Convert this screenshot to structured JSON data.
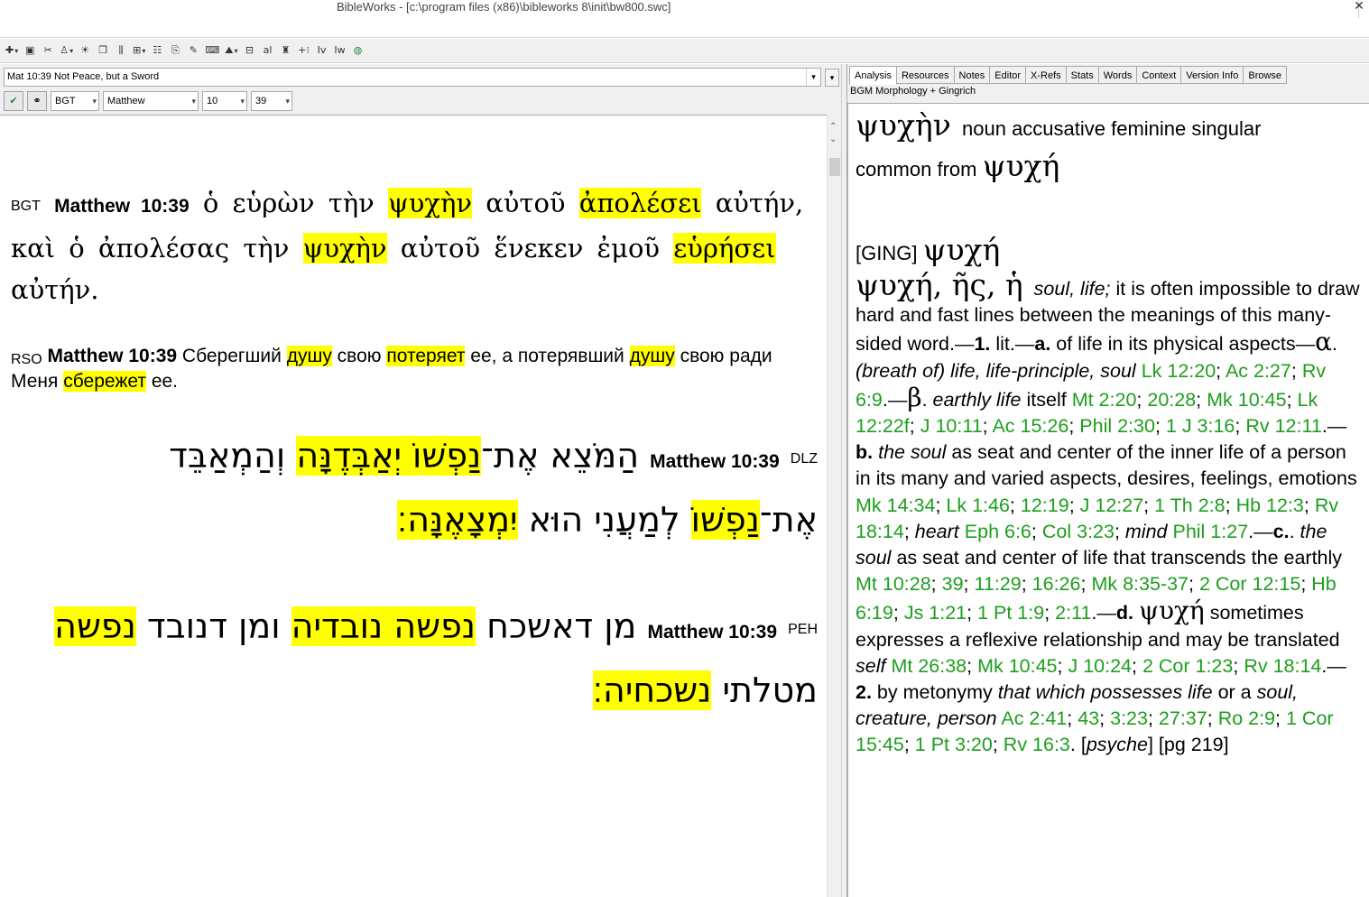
{
  "window": {
    "title": "BibleWorks - [c:\\program files (x86)\\bibleworks 8\\init\\bw800.swc]",
    "close_glyph": "✕"
  },
  "toolbar": {
    "buttons": [
      {
        "name": "toolbar-1-icon",
        "glyph": "✚",
        "dropdown": true
      },
      {
        "name": "toolbar-2-icon",
        "glyph": "▣",
        "dropdown": false
      },
      {
        "name": "toolbar-3-icon",
        "glyph": "✂",
        "dropdown": false
      },
      {
        "name": "toolbar-4-icon",
        "glyph": "♙",
        "dropdown": true
      },
      {
        "name": "toolbar-5-icon",
        "glyph": "☀",
        "dropdown": false
      },
      {
        "name": "toolbar-6-icon",
        "glyph": "❐",
        "dropdown": false
      },
      {
        "name": "toolbar-7-icon",
        "glyph": "⫼",
        "dropdown": false
      },
      {
        "name": "toolbar-8-icon",
        "glyph": "⊞",
        "dropdown": true
      },
      {
        "name": "toolbar-9-icon",
        "glyph": "☷",
        "dropdown": false
      },
      {
        "name": "toolbar-10-icon",
        "glyph": "⎘",
        "dropdown": false
      },
      {
        "name": "toolbar-11-icon",
        "glyph": "✎",
        "dropdown": false
      },
      {
        "name": "toolbar-12-icon",
        "glyph": "⌨",
        "dropdown": false
      },
      {
        "name": "toolbar-13-icon",
        "glyph": "⛰",
        "dropdown": true
      },
      {
        "name": "toolbar-14-icon",
        "glyph": "⊟",
        "dropdown": false
      },
      {
        "name": "toolbar-15-icon",
        "glyph": "al",
        "dropdown": false
      },
      {
        "name": "toolbar-16-icon",
        "glyph": "♜",
        "dropdown": false
      },
      {
        "name": "toolbar-17-icon",
        "glyph": "+⁝",
        "dropdown": false
      },
      {
        "name": "toolbar-18-icon",
        "glyph": "Iv",
        "dropdown": false
      },
      {
        "name": "toolbar-19-icon",
        "glyph": "Iw",
        "dropdown": false
      },
      {
        "name": "globe-icon",
        "glyph": "◍",
        "dropdown": false
      }
    ]
  },
  "left": {
    "reference_box": "Mat 10:39 Not Peace, but a Sword",
    "dropdown_glyph": "▾",
    "version": "BGT",
    "book": "Matthew",
    "chapter": "10",
    "verse": "39"
  },
  "verses": {
    "bgt": {
      "version": "BGT",
      "ref": "Matthew 10:39",
      "t1": "ὁ εὑρὼν τὴν",
      "h1": "ψυχὴν",
      "t2": "αὐτοῦ",
      "h2": "ἀπολέσει",
      "t3": "αὐτήν, καὶ ὁ ἀπολέσας τὴν",
      "h3": "ψυχὴν",
      "t4": "αὐτοῦ ἕνεκεν ἐμοῦ",
      "h4": "εὑρήσει",
      "t5": "αὐτήν."
    },
    "rso": {
      "version": "RSO",
      "ref": "Matthew 10:39",
      "t1": "Сберегший",
      "h1": "душу",
      "t2": "свою",
      "h2": "потеряет",
      "t3": "ее, а потерявший",
      "h3": "душу",
      "t4": "свою ради Меня",
      "h4": "сбережет",
      "t5": "ее."
    },
    "dlz": {
      "version": "DLZ",
      "ref": "Matthew 10:39",
      "t1": "הַמֹּצֵא אֶת־",
      "h1": "נַפְשׁוֹ יְאַבְּדֶנָּה",
      "t2": "וְהַמְאַבֵּד אֶת־",
      "h2": "נַפְשׁוֹ",
      "t3": "לְמַעֲנִי הוּא",
      "h3": "יִמְצָאֶנָּה׃"
    },
    "peh": {
      "version": "PEH",
      "ref": "Matthew 10:39",
      "t1": "מן דאשכח",
      "h1": "נפשה נובדיה",
      "t2": "ומן דנובד",
      "h2": "נפשה",
      "t3": "מטלתי",
      "h3": "נשכחיה׃"
    }
  },
  "right": {
    "tabs": [
      "Analysis",
      "Resources",
      "Notes",
      "Editor",
      "X-Refs",
      "Stats",
      "Words",
      "Context",
      "Version Info",
      "Browse"
    ],
    "active_tab": "Analysis",
    "sublabel": "BGM Morphology + Gingrich",
    "analysis": {
      "word": "ψυχὴν",
      "parse": "noun accusative feminine singular",
      "common_from": "common from",
      "lemma": "ψυχή",
      "ging_tag": "[GING]",
      "ging_lemma": "ψυχή",
      "entry_head": "ψυχή, ῆς, ἡ",
      "gloss": "soul, life;",
      "intro": "it is often impossible to draw hard and fast lines between the meanings of this many-sided word.—",
      "s1": "1.",
      "s1_text": "lit.—",
      "sa": "a.",
      "sa_text": "of life in its physical aspects—",
      "alpha": "α",
      "alpha_dot": ".",
      "alpha_gloss": "(breath of) life, life-principle, soul",
      "alpha_refs": [
        "Lk 12:20",
        "Ac 2:27",
        "Rv 6:9"
      ],
      "beta": "β",
      "beta_gloss": "earthly life",
      "itself": "itself",
      "beta_refs": [
        "Mt 2:20",
        "20:28",
        "Mk 10:45",
        "Lk 12:22f",
        "J 10:11",
        "Ac 15:26",
        "Phil 2:30",
        "1 J 3:16",
        "Rv 12:11"
      ],
      "sb": "b.",
      "sb_gloss": "the soul",
      "sb_text": "as seat and center of the inner life of a person in its many and varied aspects, desires, feelings, emotions",
      "sb_refs": [
        "Mk 14:34",
        "Lk 1:46",
        "12:19",
        "J 12:27",
        "1 Th 2:8",
        "Hb 12:3",
        "Rv 18:14"
      ],
      "heart": "heart",
      "heart_refs": [
        "Eph 6:6",
        "Col 3:23"
      ],
      "mind": "mind",
      "mind_refs": [
        "Phil 1:27"
      ],
      "sc": "c.",
      "sc_gloss": "the soul",
      "sc_text": "as seat and center of life that transcends the earthly",
      "sc_refs": [
        "Mt 10:28",
        "39",
        "11:29",
        "16:26",
        "Mk 8:35-37",
        "2 Cor 12:15",
        "Hb 6:19",
        "Js 1:21",
        "1 Pt 1:9",
        "2:11"
      ],
      "sd": "d.",
      "sd_word": "ψυχή",
      "sd_text": "sometimes expresses a reflexive relationship and may be translated",
      "self": "self",
      "sd_refs": [
        "Mt 26:38",
        "Mk 10:45",
        "J 10:24",
        "2 Cor 1:23",
        "Rv 18:14"
      ],
      "s2": "2.",
      "s2_text": "by metonymy",
      "s2_gloss": "that which possesses life",
      "or_a": "or a",
      "s2_gloss2": "soul, creature, person",
      "s2_refs": [
        "Ac 2:41",
        "43",
        "3:23",
        "27:37",
        "Ro 2:9",
        "1 Cor 15:45",
        "1 Pt 3:20",
        "Rv 16:3"
      ],
      "psyche": "psyche",
      "page": "[pg 219]"
    }
  }
}
